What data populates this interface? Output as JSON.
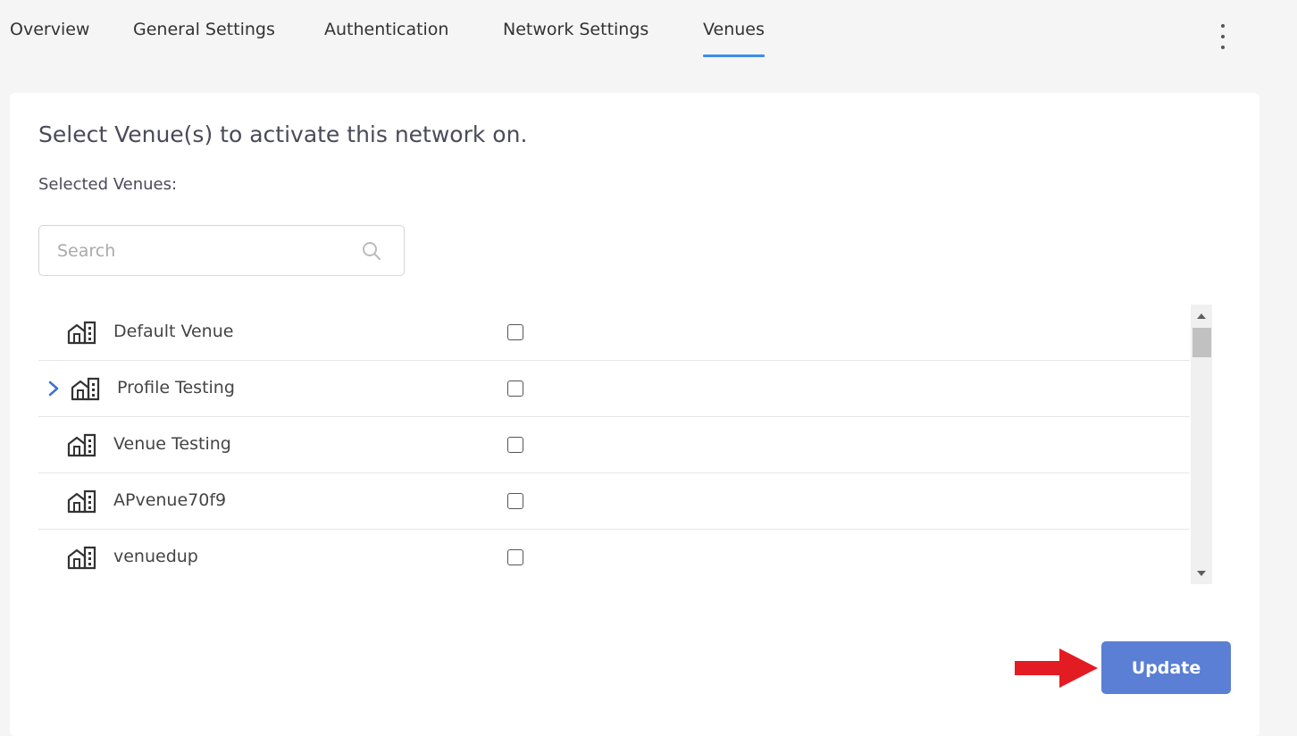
{
  "tabs": [
    {
      "label": "Overview",
      "active": false
    },
    {
      "label": "General Settings",
      "active": false
    },
    {
      "label": "Authentication",
      "active": false
    },
    {
      "label": "Network Settings",
      "active": false
    },
    {
      "label": "Venues",
      "active": true
    }
  ],
  "header": {
    "more_icon": "kebab-vertical-icon"
  },
  "card": {
    "heading": "Select Venue(s) to activate this network on.",
    "selected_label": "Selected Venues:",
    "search": {
      "placeholder": "Search",
      "value": "",
      "icon": "search-icon"
    },
    "venues": [
      {
        "name": "Default Venue",
        "checked": false,
        "expandable": false,
        "icon": "building-icon"
      },
      {
        "name": "Profile Testing",
        "checked": false,
        "expandable": true,
        "icon": "building-icon"
      },
      {
        "name": "Venue Testing",
        "checked": false,
        "expandable": false,
        "icon": "building-icon"
      },
      {
        "name": "APvenue70f9",
        "checked": false,
        "expandable": false,
        "icon": "building-icon"
      },
      {
        "name": "venuedup",
        "checked": false,
        "expandable": false,
        "icon": "building-icon"
      }
    ],
    "update_label": "Update"
  },
  "colors": {
    "accent": "#3b8ded",
    "button": "#5a7fd4",
    "annotation_arrow": "#e31b23",
    "expand_chevron": "#3b6fd6"
  }
}
